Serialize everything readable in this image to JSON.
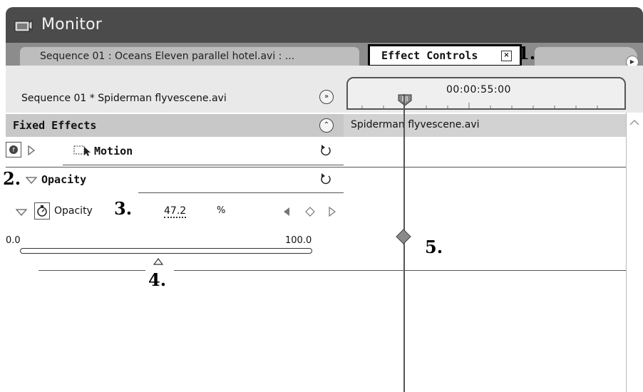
{
  "window": {
    "title": "Monitor",
    "icon": "monitor-icon"
  },
  "tabs": {
    "sequence_tab": "Sequence 01 : Oceans Eleven parallel hotel.avi : ...",
    "effect_controls": "Effect Controls",
    "close_glyph": "×",
    "menu_icon": "panel-menu-icon"
  },
  "callouts": {
    "c1": "1.",
    "c2": "2.",
    "c3": "3.",
    "c4": "4.",
    "c5": "5."
  },
  "effects": {
    "clip_name": "Sequence 01 * Spiderman flyvescene.avi",
    "section_title": "Fixed Effects",
    "motion_label": "Motion",
    "opacity_group_label": "Opacity",
    "opacity_param_label": "Opacity",
    "opacity_value": "47.2",
    "opacity_unit": "%",
    "slider": {
      "min_label": "0.0",
      "max_label": "100.0",
      "value": 47.2
    }
  },
  "timeline": {
    "timecode": "00:00:55:00",
    "clip_name": "Spiderman flyvescene.avi"
  },
  "colors": {
    "titlebar": "#4b4b4b",
    "tabbar": "#8c8c8c",
    "header": "#c8c8c8"
  }
}
